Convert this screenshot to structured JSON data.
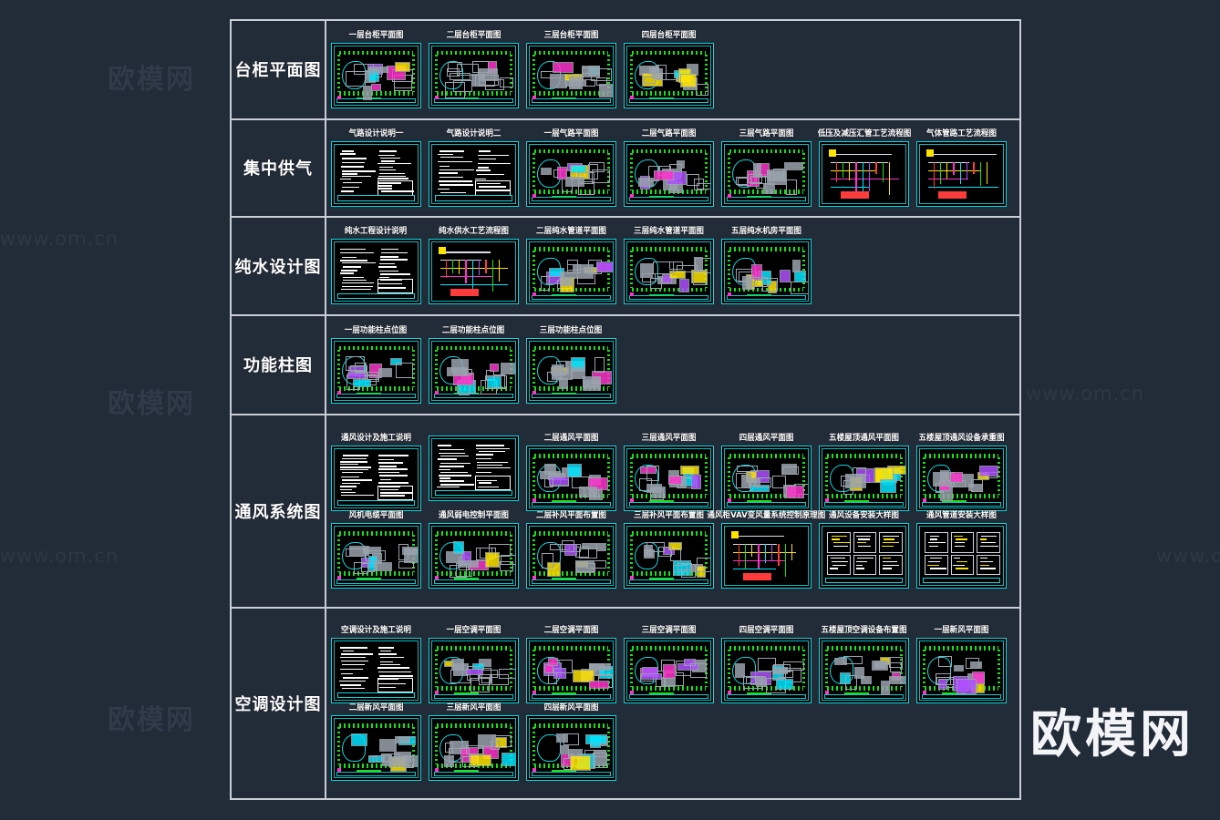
{
  "watermarks": {
    "brand": "欧模网",
    "url": "www.om.cn",
    "url_long": "www.om.cn"
  },
  "categories": [
    {
      "label": "台柜平面图",
      "rows": [
        [
          "一层台柜平面图",
          "二层台柜平面图",
          "三层台柜平面图",
          "四层台柜平面图"
        ]
      ],
      "kinds": [
        [
          "plan",
          "plan",
          "plan",
          "plan"
        ]
      ]
    },
    {
      "label": "集中供气",
      "rows": [
        [
          "气路设计说明一",
          "气路设计说明二",
          "一层气路平面图",
          "二层气路平面图",
          "三层气路平面图",
          "低压及减压汇管工艺流程图",
          "气体管路工艺流程图"
        ]
      ],
      "kinds": [
        [
          "doc",
          "doc",
          "plan",
          "plan",
          "plan",
          "flow",
          "flow"
        ]
      ]
    },
    {
      "label": "纯水设计图",
      "rows": [
        [
          "纯水工程设计说明",
          "纯水供水工艺流程图",
          "二层纯水管道平面图",
          "三层纯水管道平面图",
          "五层纯水机房平面图"
        ]
      ],
      "kinds": [
        [
          "doc",
          "flow",
          "plan",
          "plan",
          "plan"
        ]
      ]
    },
    {
      "label": "功能柱图",
      "rows": [
        [
          "一层功能柱点位图",
          "二层功能柱点位图",
          "三层功能柱点位图"
        ]
      ],
      "kinds": [
        [
          "plan",
          "plan",
          "plan"
        ]
      ]
    },
    {
      "label": "通风系统图",
      "rows": [
        [
          "通风设计及施工说明",
          "",
          "二层通风平面图",
          "三层通风平面图",
          "四层通风平面图",
          "五楼屋顶通风平面图",
          "五楼屋顶通风设备承重图"
        ],
        [
          "风机电缆平面图",
          "通风弱电控制平面图",
          "二层补风平面布置图",
          "三层补风平面布置图",
          "通风柜VAV变风量系统控制原理图",
          "通风设备安装大样图",
          "通风管道安装大样图"
        ]
      ],
      "kinds": [
        [
          "doc",
          "doc",
          "plan",
          "plan",
          "plan",
          "plan",
          "plan"
        ],
        [
          "plan",
          "plan",
          "plan",
          "plan",
          "flow",
          "detail",
          "detail"
        ]
      ]
    },
    {
      "label": "空调设计图",
      "rows": [
        [
          "空调设计及施工说明",
          "一层空调平面图",
          "二层空调平面图",
          "三层空调平面图",
          "四层空调平面图",
          "五楼屋顶空调设备布置图",
          "一层新风平面图"
        ],
        [
          "二层新风平面图",
          "三层新风平面图",
          "四层新风平面图"
        ]
      ],
      "kinds": [
        [
          "doc",
          "plan",
          "plan",
          "plan",
          "plan",
          "plan",
          "plan"
        ],
        [
          "plan",
          "plan",
          "plan"
        ]
      ]
    }
  ],
  "colors": {
    "background": "#222b38",
    "grid_line": "#c9cdd4",
    "frame_cyan": "#11d6e0",
    "wall_green": "#18e018",
    "label_white": "#ffffff"
  }
}
